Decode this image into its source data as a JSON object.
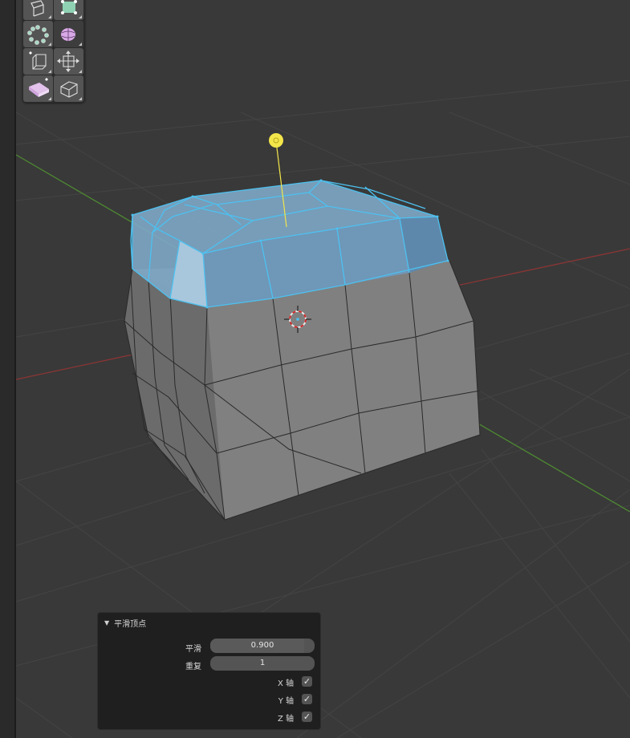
{
  "operator_panel": {
    "title": "平滑顶点",
    "smooth": {
      "label": "平滑",
      "value": "0.900",
      "fraction": 0.9
    },
    "repeat": {
      "label": "重复",
      "value": "1"
    },
    "axes": [
      {
        "label": "X 轴",
        "checked": true,
        "mark": "✓"
      },
      {
        "label": "Y 轴",
        "checked": true,
        "mark": "✓"
      },
      {
        "label": "Z 轴",
        "checked": true,
        "mark": "✓"
      }
    ]
  },
  "toolbar": {
    "tools": [
      {
        "name": "knife-tool-icon"
      },
      {
        "name": "select-box-icon"
      },
      {
        "name": "smooth-vertices-icon"
      },
      {
        "name": "randomize-icon"
      },
      {
        "name": "edge-slide-icon"
      },
      {
        "name": "shrink-fatten-icon"
      },
      {
        "name": "shear-icon"
      },
      {
        "name": "rip-region-icon"
      }
    ]
  },
  "colors": {
    "background": "#393939",
    "grid": "#454545",
    "x_axis": "#8b3535",
    "y_axis": "#4e8a32",
    "selection": "#4dc1f0",
    "light": "#f3e64a"
  }
}
